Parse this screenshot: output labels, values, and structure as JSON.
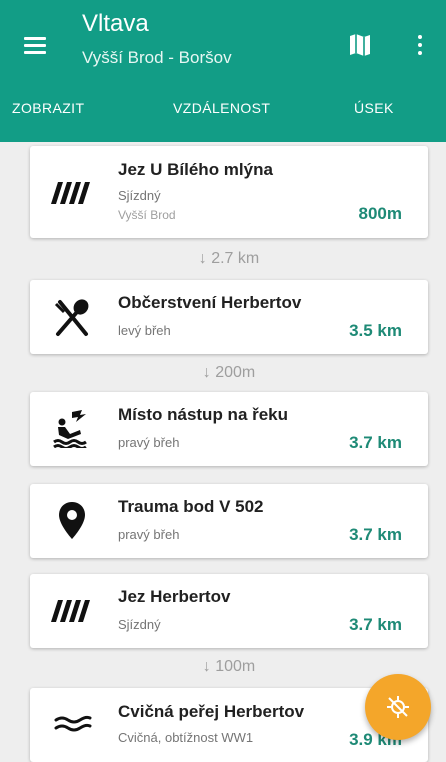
{
  "header": {
    "title": "Vltava",
    "subtitle": "Vyšší Brod - Boršov",
    "menu_icon": "menu-icon",
    "map_icon": "map-icon",
    "more_icon": "more-vert-icon"
  },
  "tabs": [
    {
      "label": "ZOBRAZIT"
    },
    {
      "label": "VZDÁLENOST"
    },
    {
      "label": "ÚSEK"
    }
  ],
  "colors": {
    "primary": "#129d86",
    "accent_text": "#1e8a76",
    "fab": "#f4a62a",
    "background": "#eeeeee"
  },
  "items": [
    {
      "icon": "weir-icon",
      "title": "Jez U Bílého mlýna",
      "line1": "Sjízdný",
      "line2": "Vyšší Brod",
      "distance": "800m"
    },
    {
      "icon": "restaurant-icon",
      "title": "Občerstvení Herbertov",
      "line1": "levý břeh",
      "distance": "3.5 km"
    },
    {
      "icon": "boat-launch-icon",
      "title": "Místo nástup na řeku",
      "line1": "pravý břeh",
      "distance": "3.7 km"
    },
    {
      "icon": "location-pin-icon",
      "title": "Trauma bod V 502",
      "line1": "pravý břeh",
      "distance": "3.7 km"
    },
    {
      "icon": "weir-icon",
      "title": "Jez Herbertov",
      "line1": "Sjízdný",
      "distance": "3.7 km"
    },
    {
      "icon": "rapids-icon",
      "title": "Cvičná peřej Herbertov",
      "line1": "Cvičná, obtížnost WW1",
      "distance": "3.9 km"
    }
  ],
  "separators": [
    {
      "text": "↓ 2.7 km"
    },
    {
      "text": "↓ 200m"
    },
    {
      "text": "↓ 100m"
    }
  ],
  "fab": {
    "icon": "gps-off-icon"
  }
}
